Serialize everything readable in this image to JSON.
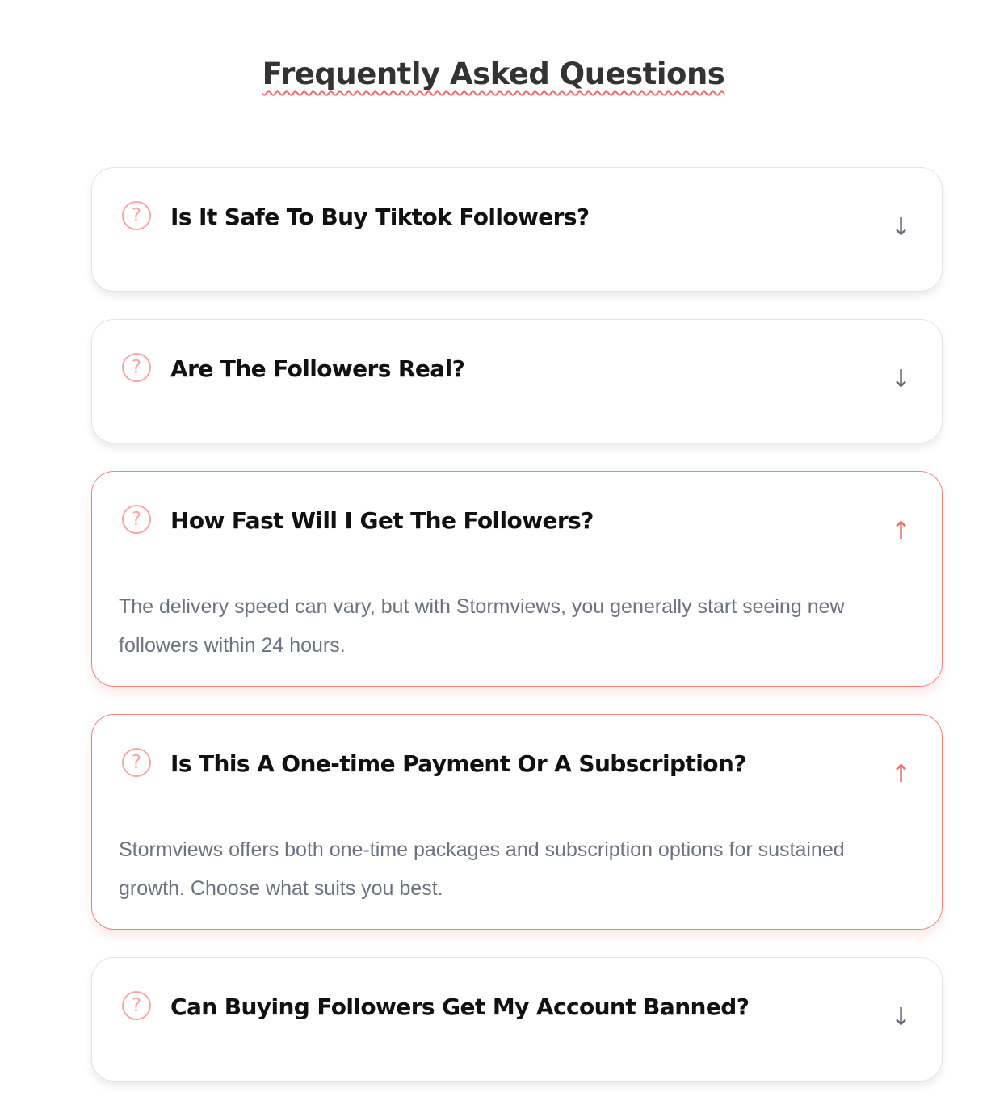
{
  "section": {
    "title": "Frequently Asked Questions"
  },
  "icons": {
    "question": "?",
    "expand": "↓",
    "collapse": "↑"
  },
  "colors": {
    "accent": "#f06b6b",
    "icon": "#f7a5a5",
    "text_muted": "#6b7280"
  },
  "faqs": [
    {
      "question": "Is It Safe To Buy Tiktok Followers?",
      "expanded": false,
      "answer": ""
    },
    {
      "question": "Are The Followers Real?",
      "expanded": false,
      "answer": ""
    },
    {
      "question": "How Fast Will I Get The Followers?",
      "expanded": true,
      "answer": "The delivery speed can vary, but with Stormviews, you generally start seeing new followers within 24 hours."
    },
    {
      "question": "Is This A One-time Payment Or A Subscription?",
      "expanded": true,
      "answer": "Stormviews offers both one-time packages and subscription options for sustained growth. Choose what suits you best."
    },
    {
      "question": "Can Buying Followers Get My Account Banned?",
      "expanded": false,
      "answer": ""
    }
  ]
}
